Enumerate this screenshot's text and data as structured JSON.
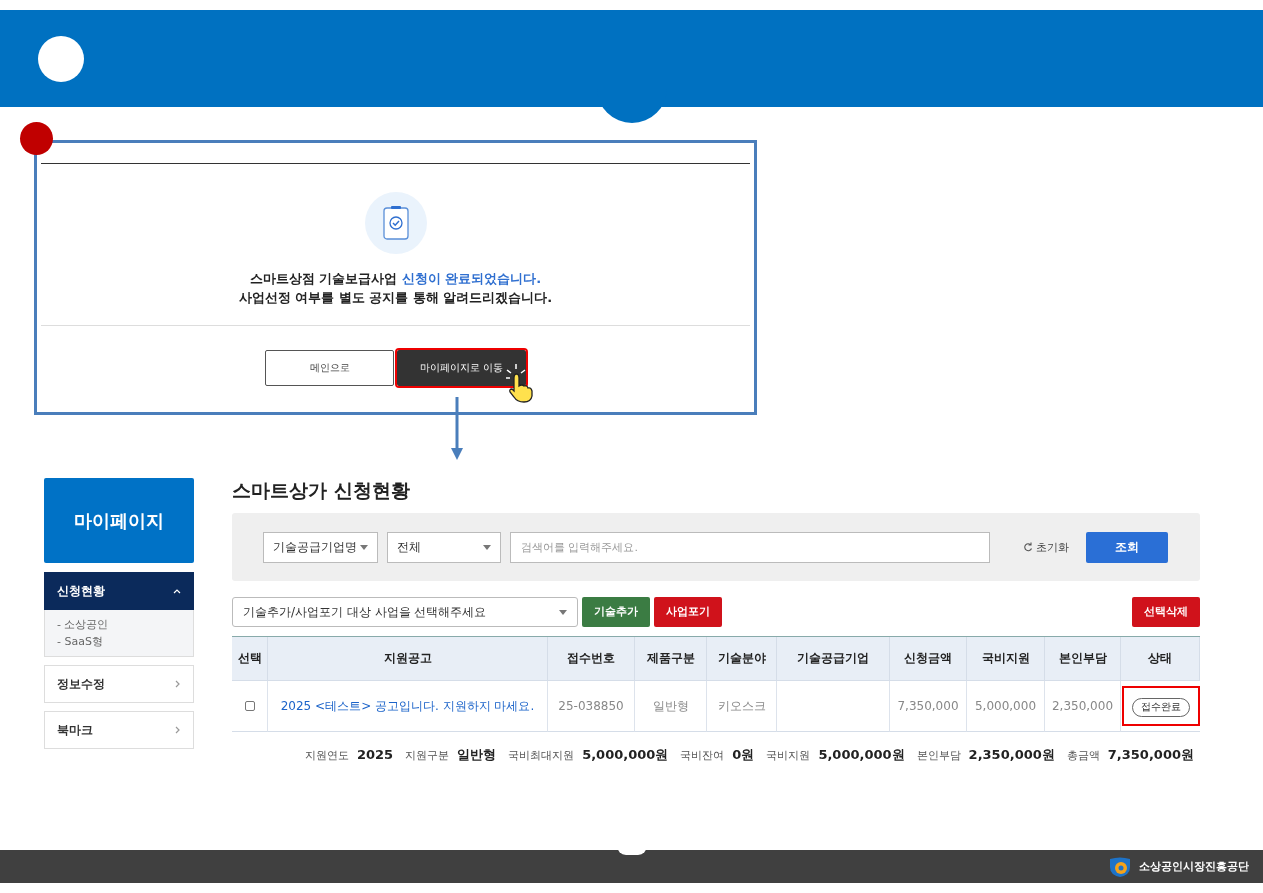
{
  "dialog": {
    "message_lines": [
      "스마트상점 기술보급사업 **신청이 완료되었습니다.**",
      "사업선정 여부를 별도 공지를 통해 알려드리겠습니다."
    ],
    "buttons": [
      {
        "label": "메인으로",
        "kind": "outline",
        "highlighted": false
      },
      {
        "label": "마이페이지로 이동",
        "kind": "dark",
        "highlighted": true
      }
    ]
  },
  "sidebar": {
    "title": "마이페이지",
    "items": [
      {
        "label": "신청현황",
        "expanded": true,
        "children": [
          {
            "label": "- 소상공인"
          },
          {
            "label": "- SaaS형"
          }
        ]
      },
      {
        "label": "정보수정",
        "expanded": false
      },
      {
        "label": "북마크",
        "expanded": false
      }
    ]
  },
  "page_title": "스마트상가 신청현황",
  "search": {
    "category": "기술공급기업명",
    "filter": "전체",
    "placeholder": "검색어를 입력해주세요.",
    "reset": "초기화",
    "submit": "조회"
  },
  "actions": {
    "select": "기술추가/사업포기 대상 사업을 선택해주세요",
    "buttons": [
      {
        "label": "기술추가",
        "kind": "green"
      },
      {
        "label": "사업포기",
        "kind": "red"
      }
    ],
    "delete": "선택삭제"
  },
  "table": {
    "columns": [
      "선택",
      "지원공고",
      "접수번호",
      "제품구분",
      "기술분야",
      "기술공급기업",
      "신청금액",
      "국비지원",
      "본인부담",
      "상태"
    ],
    "rows": [
      {
        "checked": false,
        "notice": "2025 <테스트> 공고입니다. 지원하지 마세요.",
        "receipt_no": "25-038850",
        "product_type": "일반형",
        "tech_field": "키오스크",
        "supplier": "",
        "requested": "7,350,000",
        "gov_support": "5,000,000",
        "self_pay": "2,350,000",
        "status": "접수완료",
        "status_highlighted": true
      }
    ]
  },
  "summary": [
    {
      "label": "지원연도",
      "value": "2025"
    },
    {
      "label": "지원구분",
      "value": "일반형"
    },
    {
      "label": "국비최대지원",
      "value": "5,000,000원"
    },
    {
      "label": "국비잔여",
      "value": "0원"
    },
    {
      "label": "국비지원",
      "value": "5,000,000원"
    },
    {
      "label": "본인부담",
      "value": "2,350,000원"
    },
    {
      "label": "총금액",
      "value": "7,350,000원"
    }
  ],
  "footer": {
    "org": "소상공인시장진흥공단"
  }
}
